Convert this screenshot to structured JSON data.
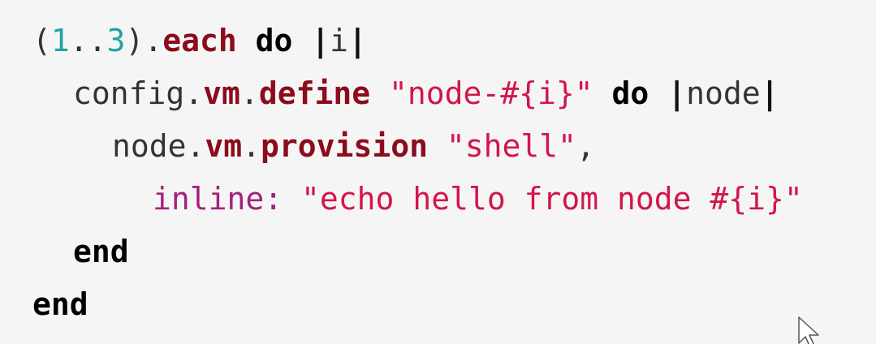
{
  "code": {
    "lines": [
      {
        "tokens": [
          {
            "t": "(",
            "k": "plain"
          },
          {
            "t": "1",
            "k": "num"
          },
          {
            "t": "..",
            "k": "plain"
          },
          {
            "t": "3",
            "k": "num"
          },
          {
            "t": ").",
            "k": "plain"
          },
          {
            "t": "each",
            "k": "meth"
          },
          {
            "t": " ",
            "k": "plain"
          },
          {
            "t": "do",
            "k": "kw"
          },
          {
            "t": " ",
            "k": "plain"
          },
          {
            "t": "|",
            "k": "pipe"
          },
          {
            "t": "i",
            "k": "plain"
          },
          {
            "t": "|",
            "k": "pipe"
          }
        ]
      },
      {
        "tokens": [
          {
            "t": "config.",
            "k": "plain"
          },
          {
            "t": "vm",
            "k": "meth"
          },
          {
            "t": ".",
            "k": "plain"
          },
          {
            "t": "define",
            "k": "meth"
          },
          {
            "t": " ",
            "k": "plain"
          },
          {
            "t": "\"node-#{i}\"",
            "k": "str"
          },
          {
            "t": " ",
            "k": "plain"
          },
          {
            "t": "do",
            "k": "kw"
          },
          {
            "t": " ",
            "k": "plain"
          },
          {
            "t": "|",
            "k": "pipe"
          },
          {
            "t": "node",
            "k": "plain"
          },
          {
            "t": "|",
            "k": "pipe"
          }
        ]
      },
      {
        "tokens": [
          {
            "t": "node.",
            "k": "plain"
          },
          {
            "t": "vm",
            "k": "meth"
          },
          {
            "t": ".",
            "k": "plain"
          },
          {
            "t": "provision",
            "k": "meth"
          },
          {
            "t": " ",
            "k": "plain"
          },
          {
            "t": "\"shell\"",
            "k": "str"
          },
          {
            "t": ",",
            "k": "plain"
          }
        ]
      },
      {
        "tokens": [
          {
            "t": "inline:",
            "k": "sym"
          },
          {
            "t": " ",
            "k": "plain"
          },
          {
            "t": "\"echo hello from node #{i}\"",
            "k": "str"
          }
        ]
      },
      {
        "tokens": [
          {
            "t": "end",
            "k": "kw"
          }
        ]
      },
      {
        "tokens": [
          {
            "t": "end",
            "k": "kw"
          }
        ]
      }
    ]
  },
  "colors": {
    "background": "#f5f5f5",
    "number": "#20a3a3",
    "method": "#8b0c1c",
    "keyword": "#000000",
    "string": "#d2164a",
    "symbol": "#a3217d"
  },
  "cursor": {
    "icon": "mouse-pointer-icon"
  }
}
